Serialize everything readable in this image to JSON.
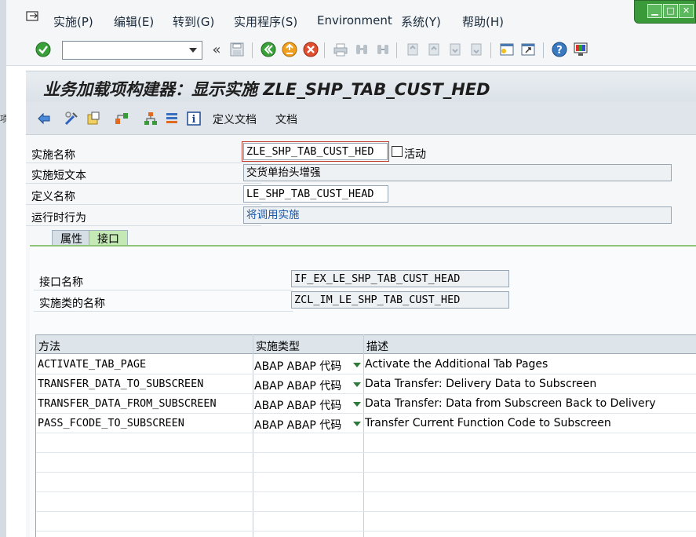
{
  "menu": {
    "items": [
      "实施(P)",
      "编辑(E)",
      "转到(G)",
      "实用程序(S)",
      "Environment",
      "系统(Y)",
      "帮助(H)"
    ]
  },
  "toolbar": {
    "command_value": "",
    "back_glyph": "«"
  },
  "title": "业务加载项构建器：显示实施 ZLE_SHP_TAB_CUST_HED",
  "app_toolbar": {
    "define_doc_label": "定义文档",
    "doc_label": "文档"
  },
  "fields": {
    "impl_name_label": "实施名称",
    "impl_name_value": "ZLE_SHP_TAB_CUST_HED",
    "active_label": "活动",
    "short_text_label": "实施短文本",
    "short_text_value": "交货单抬头增强",
    "def_name_label": "定义名称",
    "def_name_value": "LE_SHP_TAB_CUST_HEAD",
    "runtime_label": "运行时行为",
    "runtime_value": "将调用实施"
  },
  "tabs": [
    "属性",
    "接口"
  ],
  "interface": {
    "iface_label": "接口名称",
    "iface_value": "IF_EX_LE_SHP_TAB_CUST_HEAD",
    "class_label": "实施类的名称",
    "class_value": "ZCL_IM_LE_SHP_TAB_CUST_HED"
  },
  "grid": {
    "headers": [
      "方法",
      "实施类型",
      "描述"
    ],
    "rows": [
      {
        "method": "ACTIVATE_TAB_PAGE",
        "type": "ABAP ABAP 代码",
        "desc": "Activate the Additional Tab Pages"
      },
      {
        "method": "TRANSFER_DATA_TO_SUBSCREEN",
        "type": "ABAP ABAP 代码",
        "desc": "Data Transfer: Delivery Data to Subscreen"
      },
      {
        "method": "TRANSFER_DATA_FROM_SUBSCREEN",
        "type": "ABAP ABAP 代码",
        "desc": "Data Transfer: Data from Subscreen Back to Delivery"
      },
      {
        "method": "PASS_FCODE_TO_SUBSCREEN",
        "type": "ABAP ABAP 代码",
        "desc": "Transfer Current Function Code to Subscreen"
      }
    ]
  },
  "colors": {
    "title_bg": "#dbe2e8",
    "active_tab": "#c4e9b4",
    "link_blue": "#1d5aa8",
    "window_green": "#3a9a3a"
  }
}
